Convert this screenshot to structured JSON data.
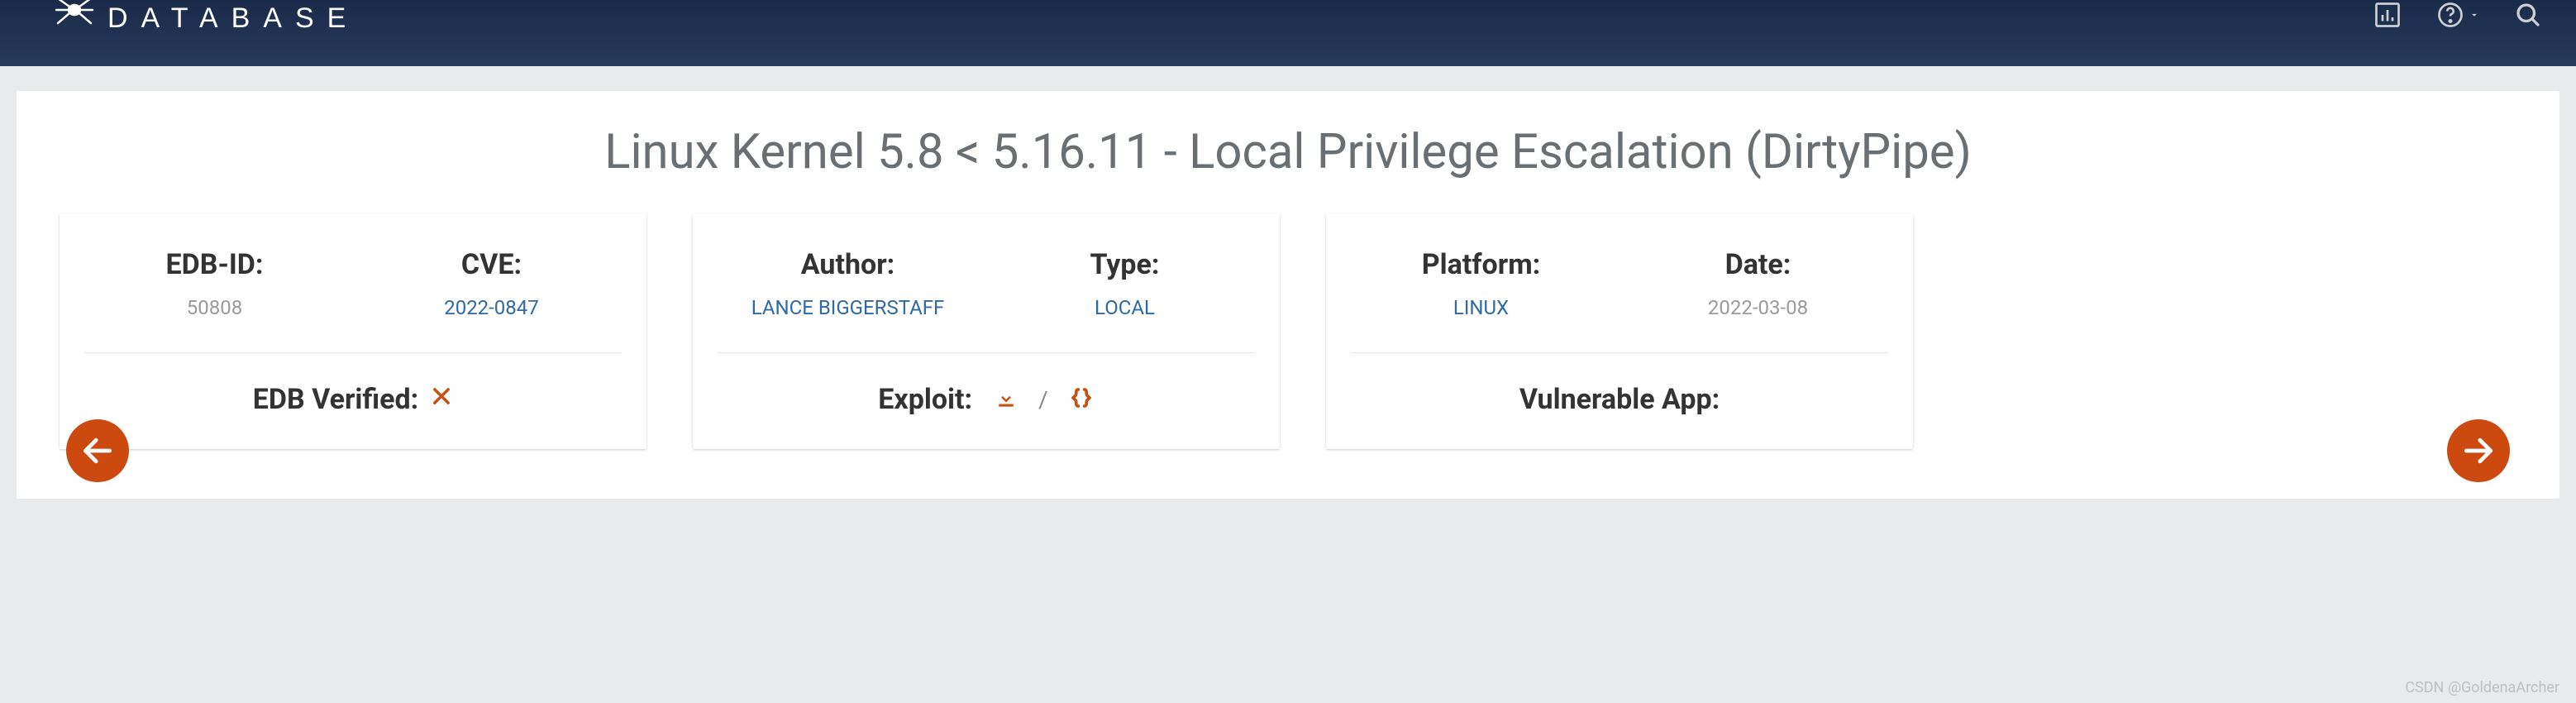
{
  "brand": {
    "subtitle": "DATABASE"
  },
  "page": {
    "title": "Linux Kernel 5.8 < 5.16.11 - Local Privilege Escalation (DirtyPipe)"
  },
  "card1": {
    "edb_label": "EDB-ID:",
    "edb_value": "50808",
    "cve_label": "CVE:",
    "cve_value": "2022-0847",
    "verified_label": "EDB Verified:"
  },
  "card2": {
    "author_label": "Author:",
    "author_value": "LANCE BIGGERSTAFF",
    "type_label": "Type:",
    "type_value": "LOCAL",
    "exploit_label": "Exploit:",
    "slash": "/"
  },
  "card3": {
    "platform_label": "Platform:",
    "platform_value": "LINUX",
    "date_label": "Date:",
    "date_value": "2022-03-08",
    "vuln_label": "Vulnerable App:"
  },
  "watermark": "CSDN @GoldenaArcher"
}
